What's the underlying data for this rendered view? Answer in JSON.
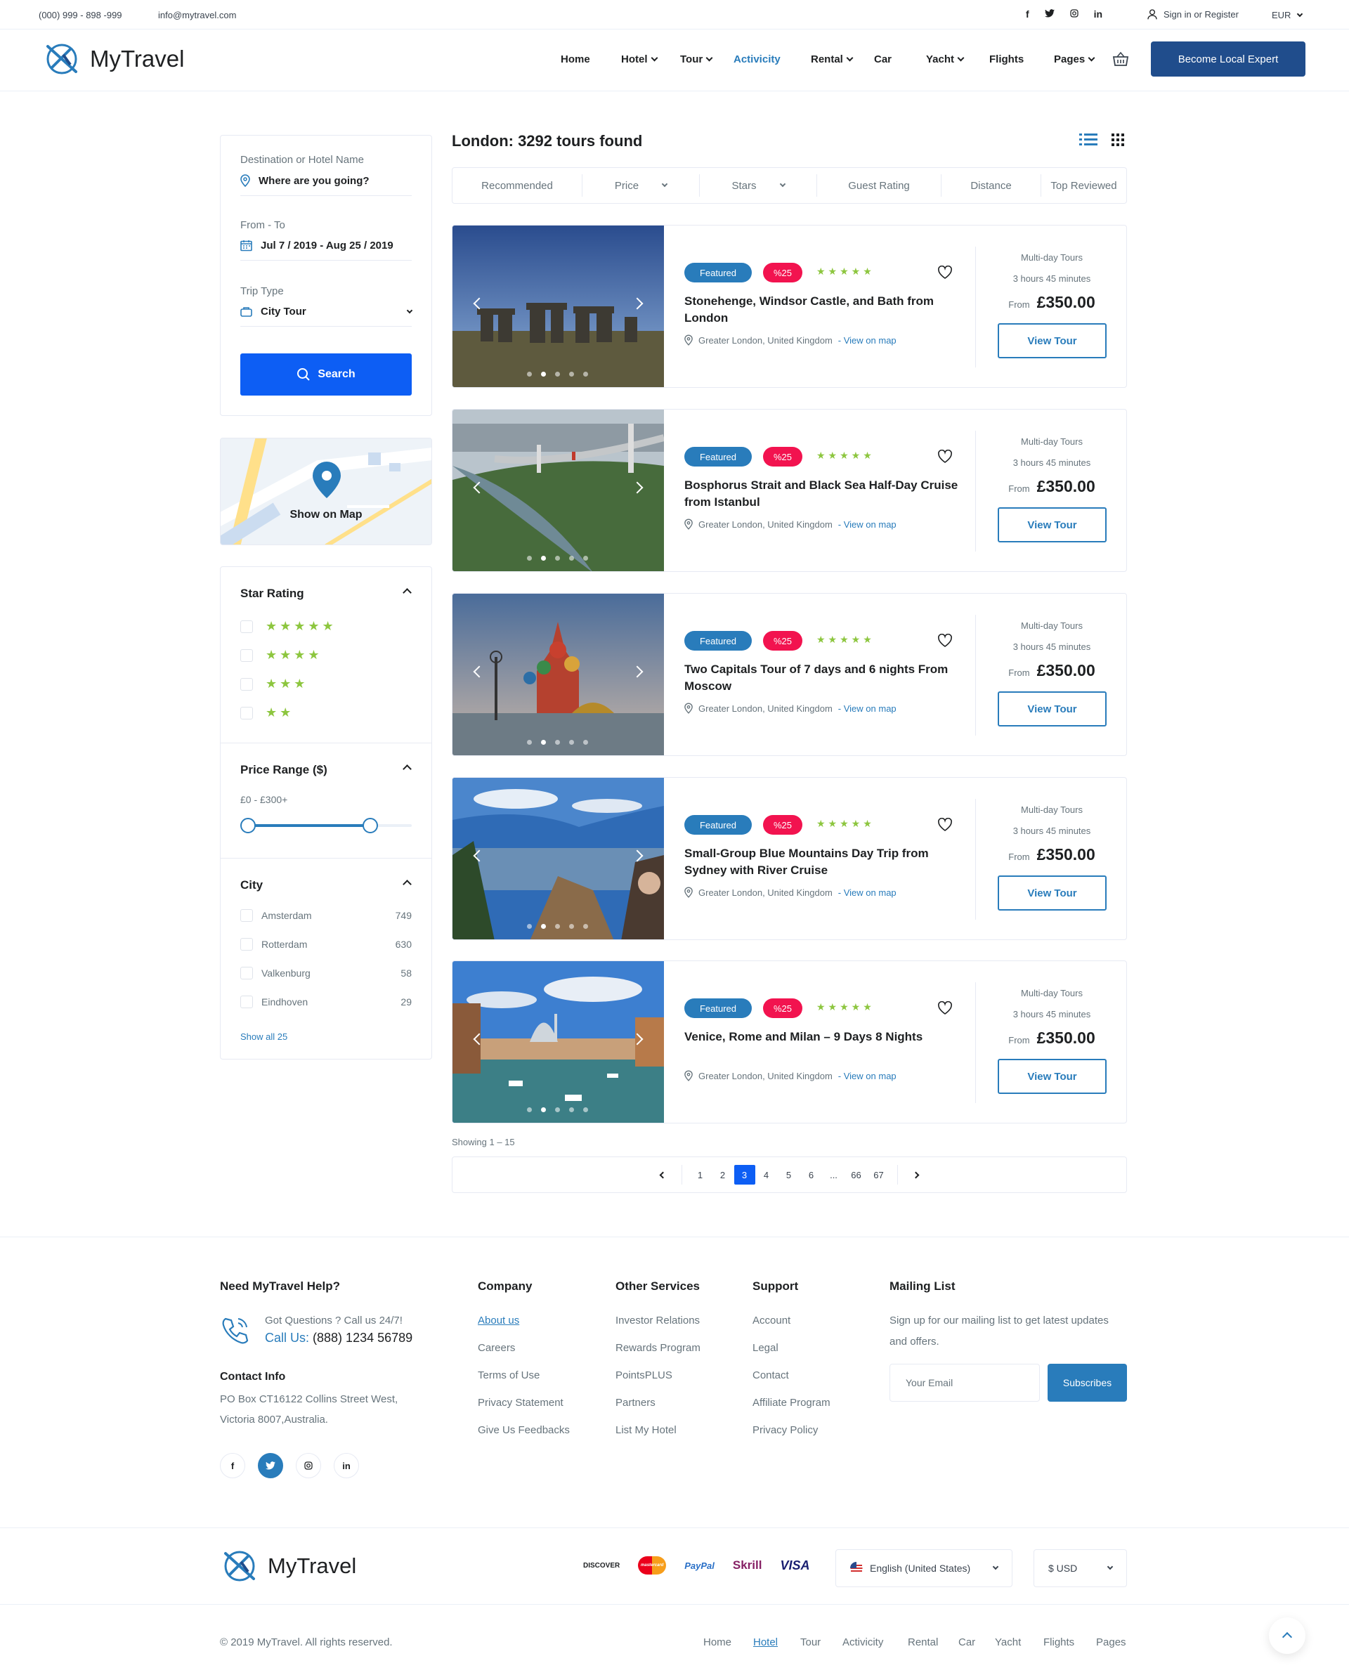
{
  "topbar": {
    "phone": "(000) 999 - 898 -999",
    "email": "info@mytravel.com",
    "social": [
      "f",
      "t",
      "ig",
      "in"
    ],
    "signin": "Sign in or Register",
    "currency": "EUR"
  },
  "brand": {
    "name": "MyTravel",
    "accent": "#297cbb",
    "primary": "#0d5ef4",
    "dark_blue": "#204d8c"
  },
  "nav": {
    "items": [
      {
        "label": "Home",
        "dropdown": false
      },
      {
        "label": "Hotel",
        "dropdown": true
      },
      {
        "label": "Tour",
        "dropdown": true
      },
      {
        "label": "Activicity",
        "dropdown": false,
        "active": true
      },
      {
        "label": "Rental",
        "dropdown": true
      },
      {
        "label": "Car",
        "dropdown": false
      },
      {
        "label": "Yacht",
        "dropdown": true
      },
      {
        "label": "Flights",
        "dropdown": false
      },
      {
        "label": "Pages",
        "dropdown": true
      }
    ],
    "cta": "Become Local Expert"
  },
  "search": {
    "destination_label": "Destination or Hotel Name",
    "destination_placeholder": "Where are you going?",
    "dates_label": "From - To",
    "dates_value": "Jul 7 / 2019 - Aug 25 / 2019",
    "trip_label": "Trip Type",
    "trip_value": "City Tour",
    "button": "Search"
  },
  "map": {
    "label": "Show on Map"
  },
  "filters": {
    "star_title": "Star Rating",
    "star_options": [
      5,
      4,
      3,
      2
    ],
    "price_title": "Price Range ($)",
    "price_range": "£0 - £300+",
    "city_title": "City",
    "cities": [
      {
        "name": "Amsterdam",
        "count": "749"
      },
      {
        "name": "Rotterdam",
        "count": "630"
      },
      {
        "name": "Valkenburg",
        "count": "58"
      },
      {
        "name": "Eindhoven",
        "count": "29"
      }
    ],
    "show_all": "Show all 25"
  },
  "results": {
    "title": "London: 3292 tours found",
    "sort": [
      "Recommended",
      "Price",
      "Stars",
      "Guest Rating",
      "Distance",
      "Top Reviewed"
    ]
  },
  "tours": [
    {
      "name": "Stonehenge, Windsor Castle, and Bath from London",
      "featured": "Featured",
      "discount": "%25",
      "location": "Greater London, United Kingdom",
      "map_link": "- View on map",
      "type": "Multi-day Tours",
      "duration": "3 hours 45 minutes",
      "from": "From",
      "price": "£350.00",
      "button": "View Tour"
    },
    {
      "name": "Bosphorus Strait and Black Sea Half-Day Cruise from Istanbul",
      "featured": "Featured",
      "discount": "%25",
      "location": "Greater London, United Kingdom",
      "map_link": "- View on map",
      "type": "Multi-day Tours",
      "duration": "3 hours 45 minutes",
      "from": "From",
      "price": "£350.00",
      "button": "View Tour"
    },
    {
      "name": "Two Capitals Tour of 7 days and 6 nights From Moscow",
      "featured": "Featured",
      "discount": "%25",
      "location": "Greater London, United Kingdom",
      "map_link": "- View on map",
      "type": "Multi-day Tours",
      "duration": "3 hours 45 minutes",
      "from": "From",
      "price": "£350.00",
      "button": "View Tour"
    },
    {
      "name": "Small-Group Blue Mountains Day Trip from Sydney with River Cruise",
      "featured": "Featured",
      "discount": "%25",
      "location": "Greater London, United Kingdom",
      "map_link": "- View on map",
      "type": "Multi-day Tours",
      "duration": "3 hours 45 minutes",
      "from": "From",
      "price": "£350.00",
      "button": "View Tour"
    },
    {
      "name": "Venice, Rome and Milan – 9 Days 8 Nights",
      "featured": "Featured",
      "discount": "%25",
      "location": "Greater London, United Kingdom",
      "map_link": "- View on map",
      "type": "Multi-day Tours",
      "duration": "3 hours 45 minutes",
      "from": "From",
      "price": "£350.00",
      "button": "View Tour"
    }
  ],
  "pagination": {
    "showing": "Showing 1 – 15",
    "pages": [
      "1",
      "2",
      "3",
      "4",
      "5",
      "6",
      "...",
      "66",
      "67"
    ],
    "current": "3"
  },
  "footer": {
    "help_title": "Need MyTravel Help?",
    "got_questions": "Got Questions ? Call us 24/7!",
    "call_label": "Call Us:",
    "call_number": "(888) 1234 56789",
    "contact_title": "Contact Info",
    "address_line1": "PO Box CT16122 Collins Street West,",
    "address_line2": "Victoria 8007,Australia.",
    "company_title": "Company",
    "company_links": [
      "About us",
      "Careers",
      "Terms of Use",
      "Privacy Statement",
      "Give Us Feedbacks"
    ],
    "services_title": "Other Services",
    "services_links": [
      "Investor Relations",
      "Rewards Program",
      "PointsPLUS",
      "Partners",
      "List My Hotel"
    ],
    "support_title": "Support",
    "support_links": [
      "Account",
      "Legal",
      "Contact",
      "Affiliate Program",
      "Privacy Policy"
    ],
    "mailing_title": "Mailing List",
    "mailing_text": "Sign up for our mailing list to get latest updates and offers.",
    "email_placeholder": "Your Email",
    "subscribe": "Subscribes",
    "payments": [
      "DISCOVER",
      "mastercard",
      "PayPal",
      "Skrill",
      "VISA"
    ],
    "language": "English (United States)",
    "currency": "$ USD",
    "copyright": "© 2019 MyTravel. All rights reserved.",
    "bottom_menu": [
      "Home",
      "Hotel",
      "Tour",
      "Activicity",
      "Rental",
      "Car",
      "Yacht",
      "Flights",
      "Pages"
    ]
  }
}
